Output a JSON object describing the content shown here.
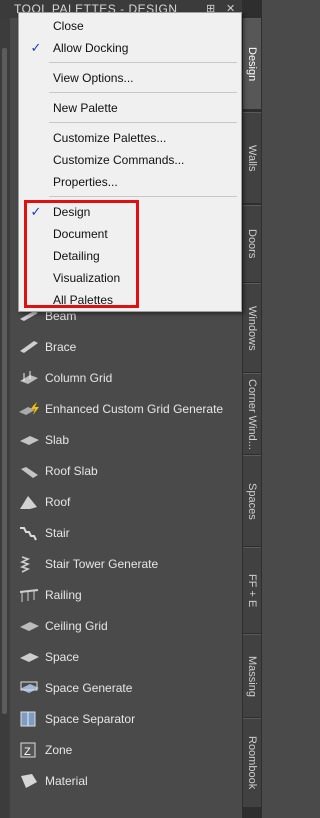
{
  "window": {
    "title": "TOOL PALETTES - DESIGN",
    "pin_icon": "pin-icon",
    "close_icon": "close-icon"
  },
  "tabs": [
    {
      "label": "Design",
      "active": true
    },
    {
      "label": "Walls",
      "active": false
    },
    {
      "label": "Doors",
      "active": false
    },
    {
      "label": "Windows",
      "active": false
    },
    {
      "label": "Corner Wind...",
      "active": false
    },
    {
      "label": "Spaces",
      "active": false
    },
    {
      "label": "FF + E",
      "active": false
    },
    {
      "label": "Massing",
      "active": false
    },
    {
      "label": "Roombook",
      "active": false
    }
  ],
  "tools": [
    {
      "label": "Beam",
      "icon": "beam-icon"
    },
    {
      "label": "Brace",
      "icon": "brace-icon"
    },
    {
      "label": "Column Grid",
      "icon": "column-grid-icon"
    },
    {
      "label": "Enhanced Custom Grid Generate",
      "icon": "grid-generate-icon"
    },
    {
      "label": "Slab",
      "icon": "slab-icon"
    },
    {
      "label": "Roof Slab",
      "icon": "roof-slab-icon"
    },
    {
      "label": "Roof",
      "icon": "roof-icon"
    },
    {
      "label": "Stair",
      "icon": "stair-icon"
    },
    {
      "label": "Stair Tower Generate",
      "icon": "stair-tower-icon"
    },
    {
      "label": "Railing",
      "icon": "railing-icon"
    },
    {
      "label": "Ceiling Grid",
      "icon": "ceiling-grid-icon"
    },
    {
      "label": "Space",
      "icon": "space-icon"
    },
    {
      "label": "Space Generate",
      "icon": "space-generate-icon"
    },
    {
      "label": "Space Separator",
      "icon": "space-separator-icon"
    },
    {
      "label": "Zone",
      "icon": "zone-icon"
    },
    {
      "label": "Material",
      "icon": "material-icon"
    }
  ],
  "menu": {
    "groups": [
      [
        {
          "label": "Close",
          "checked": false
        },
        {
          "label": "Allow Docking",
          "checked": true
        }
      ],
      [
        {
          "label": "View Options...",
          "checked": false
        }
      ],
      [
        {
          "label": "New Palette",
          "checked": false
        }
      ],
      [
        {
          "label": "Customize Palettes...",
          "checked": false
        },
        {
          "label": "Customize Commands...",
          "checked": false
        },
        {
          "label": "Properties...",
          "checked": false
        }
      ],
      [
        {
          "label": "Design",
          "checked": true
        },
        {
          "label": "Document",
          "checked": false
        },
        {
          "label": "Detailing",
          "checked": false
        },
        {
          "label": "Visualization",
          "checked": false
        },
        {
          "label": "All Palettes",
          "checked": false
        }
      ]
    ],
    "check_glyph": "✓"
  },
  "colors": {
    "highlight_box": "#e01010",
    "check_mark": "#1a3fb0"
  }
}
